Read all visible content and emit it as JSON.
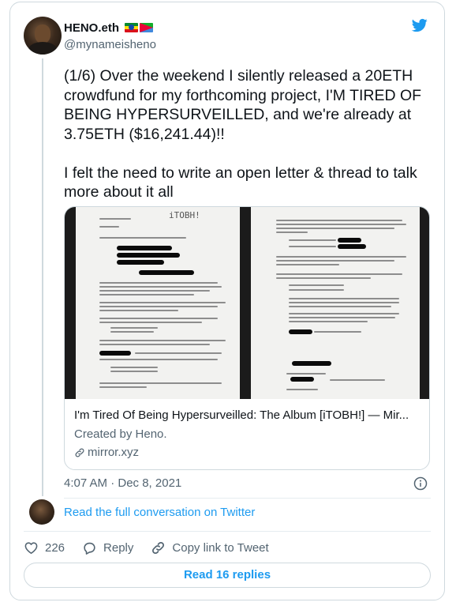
{
  "author": {
    "display_name": "HENO.eth",
    "handle": "@mynameisheno",
    "flags": [
      "ethiopia-flag",
      "eritrea-flag"
    ]
  },
  "tweet": {
    "text": "(1/6) Over the weekend I silently released a 20ETH crowdfund for my forthcoming project, I'M TIRED OF BEING HYPERSURVEILLED, and we're already at 3.75ETH ($16,241.44)!!\n\nI felt the need to write an open letter & thread to talk more about it all",
    "timestamp": "4:07 AM · Dec 8, 2021"
  },
  "link_card": {
    "image_stamp": "iTOBH!",
    "title": "I'm Tired Of Being Hypersurveilled: The Album [iTOBH!] — Mir...",
    "description": "Created by Heno.",
    "domain": "mirror.xyz"
  },
  "conversation": {
    "read_full_label": "Read the full conversation on Twitter"
  },
  "actions": {
    "like_count": "226",
    "reply_label": "Reply",
    "copy_link_label": "Copy link to Tweet",
    "read_replies_label": "Read 16 replies"
  },
  "colors": {
    "accent": "#1d9bf0",
    "text": "#0f1419",
    "muted": "#536471",
    "border": "#cfd9de"
  },
  "icons": {
    "brand": "twitter-bird-icon",
    "info": "info-icon",
    "like": "heart-icon",
    "reply": "reply-bubble-icon",
    "copy": "link-icon"
  }
}
